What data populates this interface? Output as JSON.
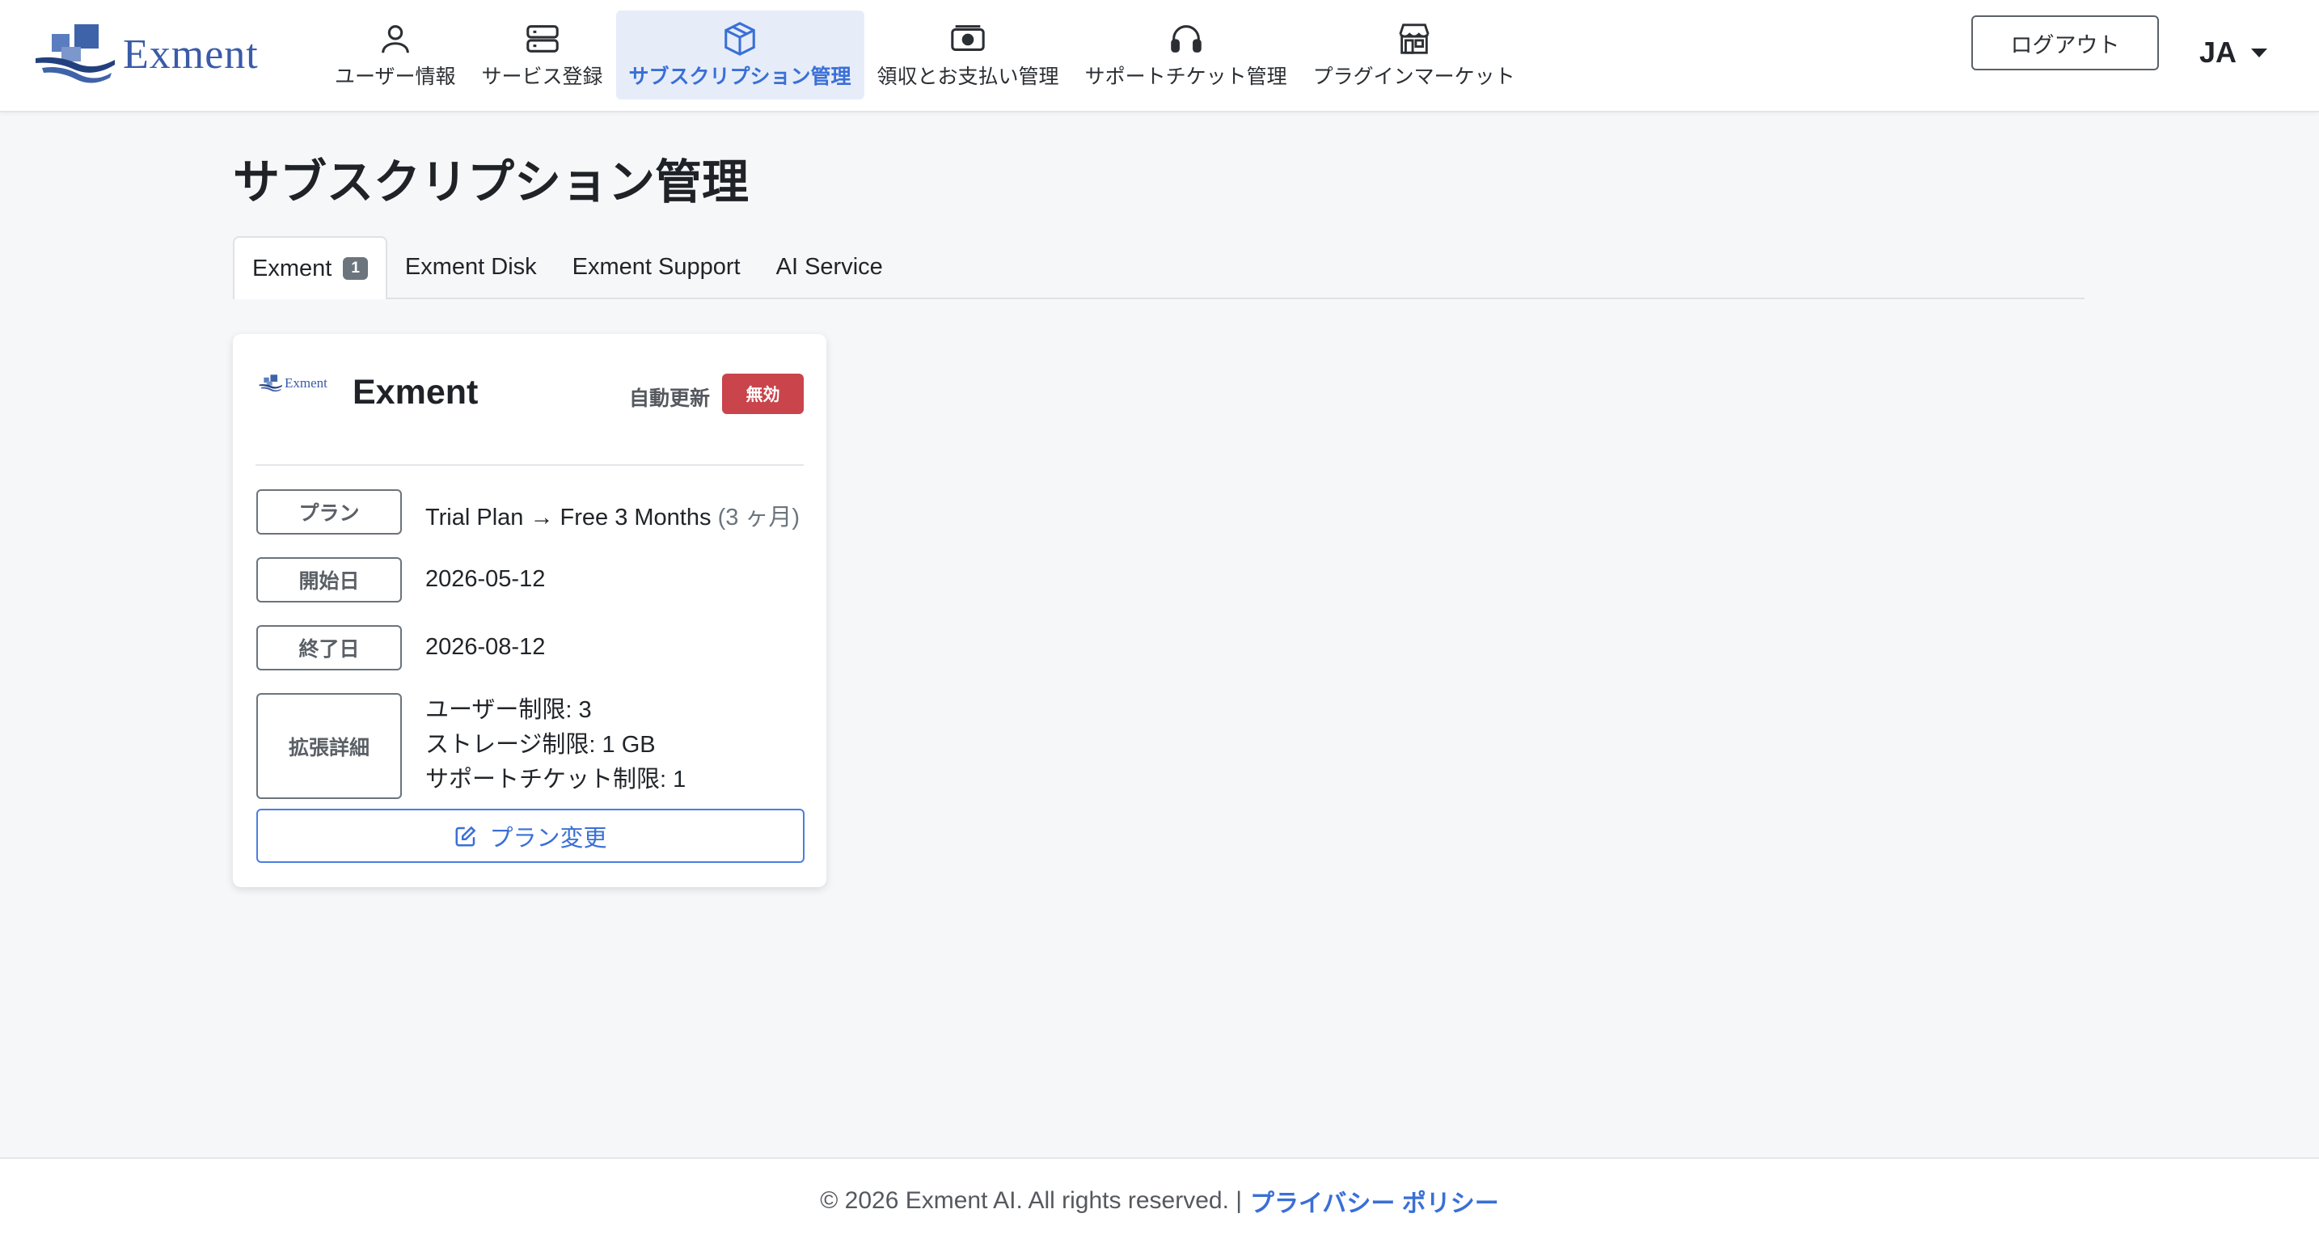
{
  "header": {
    "logo_text": "Exment",
    "nav": [
      {
        "label": "ユーザー情報",
        "icon": "user-icon"
      },
      {
        "label": "サービス登録",
        "icon": "server-icon"
      },
      {
        "label": "サブスクリプション管理",
        "icon": "box-icon",
        "active": true
      },
      {
        "label": "領収とお支払い管理",
        "icon": "cash-icon"
      },
      {
        "label": "サポートチケット管理",
        "icon": "headset-icon"
      },
      {
        "label": "プラグインマーケット",
        "icon": "shop-icon"
      }
    ],
    "logout_label": "ログアウト",
    "language": "JA"
  },
  "page": {
    "title": "サブスクリプション管理",
    "tabs": [
      {
        "label": "Exment",
        "badge": "1",
        "active": true
      },
      {
        "label": "Exment Disk"
      },
      {
        "label": "Exment Support"
      },
      {
        "label": "AI Service"
      }
    ]
  },
  "card": {
    "logo_text": "Exment",
    "title": "Exment",
    "auto_renew_label": "自動更新",
    "auto_renew_status": "無効",
    "fields": {
      "plan_label": "プラン",
      "plan_value": "Trial Plan → Free 3 Months",
      "plan_duration": "(3 ヶ月)",
      "start_label": "開始日",
      "start_value": "2026-05-12",
      "end_label": "終了日",
      "end_value": "2026-08-12",
      "ext_label": "拡張詳細",
      "ext_lines": [
        "ユーザー制限: 3",
        "ストレージ制限: 1 GB",
        "サポートチケット制限: 1"
      ]
    },
    "change_plan_label": "プラン変更"
  },
  "footer": {
    "copyright": "© 2026 Exment AI. All rights reserved. |",
    "privacy_label": "プライバシー ポリシー"
  },
  "colors": {
    "accent": "#3a6fd6",
    "danger": "#c9444b",
    "active_nav_bg": "#e6edf9"
  }
}
